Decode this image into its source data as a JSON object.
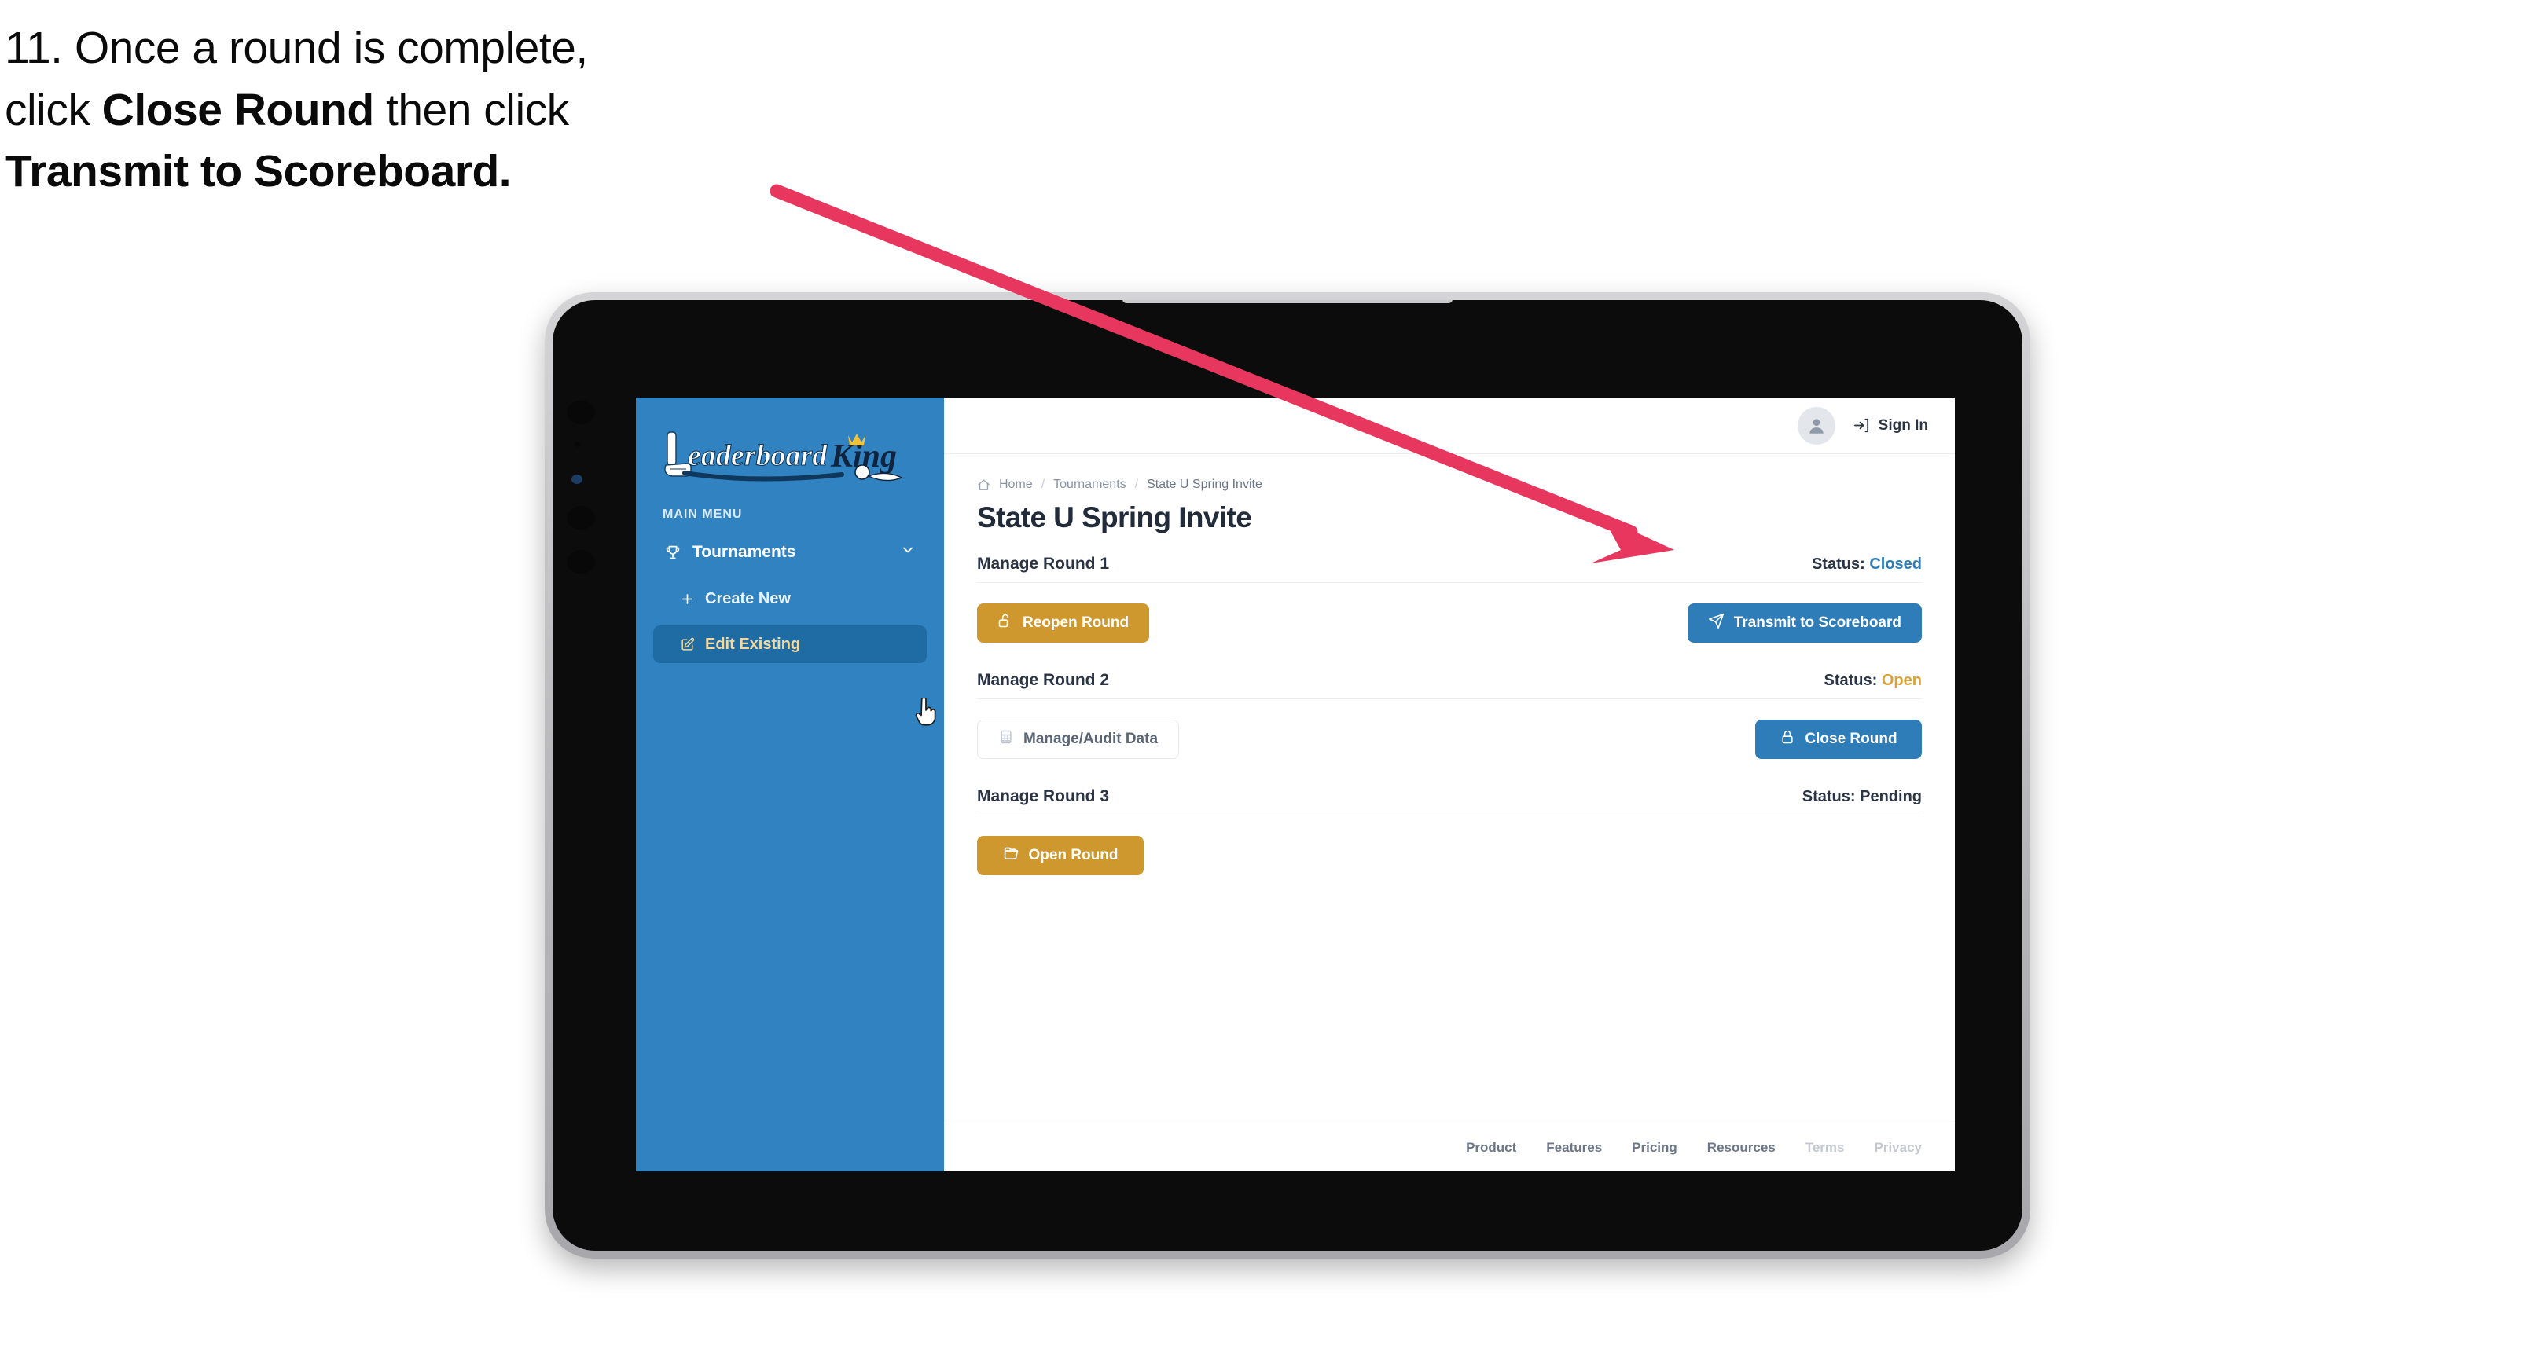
{
  "instruction": {
    "step_number": "11.",
    "line1_a": "11. Once a round is complete,",
    "line2_a": "click ",
    "line2_bold": "Close Round",
    "line2_b": " then click",
    "line3_bold": "Transmit to Scoreboard."
  },
  "annotation": {
    "arrow_color": "#e8375f",
    "points_to": "transmit-to-scoreboard-button"
  },
  "app": {
    "sidebar": {
      "logo_primary": "Leaderboard",
      "logo_secondary": "King",
      "menu_label": "MAIN MENU",
      "items": [
        {
          "label": "Tournaments",
          "icon": "trophy-icon",
          "chevron": "chevron-down-icon",
          "active": false
        },
        {
          "label": "Create New",
          "icon": "plus-icon",
          "active": false
        },
        {
          "label": "Edit Existing",
          "icon": "edit-square-icon",
          "active": true
        }
      ],
      "bg_color": "#3083c0",
      "active_bg_color": "#1f6ba4",
      "active_text_color": "#f1d9a0"
    },
    "topbar": {
      "avatar_icon": "user-avatar-icon",
      "signin_icon": "sign-in-arrow-icon",
      "signin_label": "Sign In"
    },
    "breadcrumb": {
      "home_icon": "home-icon",
      "items": [
        "Home",
        "Tournaments",
        "State U Spring Invite"
      ],
      "separator": "/"
    },
    "page_title": "State U Spring Invite",
    "rounds": [
      {
        "name": "Manage Round 1",
        "status_label": "Status:",
        "status_value": "Closed",
        "status_tone": "closed",
        "left_button": {
          "label": "Reopen Round",
          "icon": "unlock-icon",
          "style": "amber"
        },
        "right_button": {
          "label": "Transmit to Scoreboard",
          "icon": "paper-plane-icon",
          "style": "blue"
        }
      },
      {
        "name": "Manage Round 2",
        "status_label": "Status:",
        "status_value": "Open",
        "status_tone": "open",
        "left_button": {
          "label": "Manage/Audit Data",
          "icon": "table-grid-icon",
          "style": "ghost"
        },
        "right_button": {
          "label": "Close Round",
          "icon": "lock-icon",
          "style": "blue"
        }
      },
      {
        "name": "Manage Round 3",
        "status_label": "Status:",
        "status_value": "Pending",
        "status_tone": "pending",
        "left_button": {
          "label": "Open Round",
          "icon": "folder-open-icon",
          "style": "amber"
        },
        "right_button": null
      }
    ],
    "footer_links": [
      {
        "label": "Product",
        "muted": false
      },
      {
        "label": "Features",
        "muted": false
      },
      {
        "label": "Pricing",
        "muted": false
      },
      {
        "label": "Resources",
        "muted": false
      },
      {
        "label": "Terms",
        "muted": true
      },
      {
        "label": "Privacy",
        "muted": true
      }
    ],
    "colors": {
      "amber": "#ce982e",
      "blue": "#2e7db8",
      "sidebar_blue": "#3083c0",
      "text_dark": "#2b3445"
    }
  },
  "cursor": {
    "type": "pointer-hand-cursor"
  }
}
